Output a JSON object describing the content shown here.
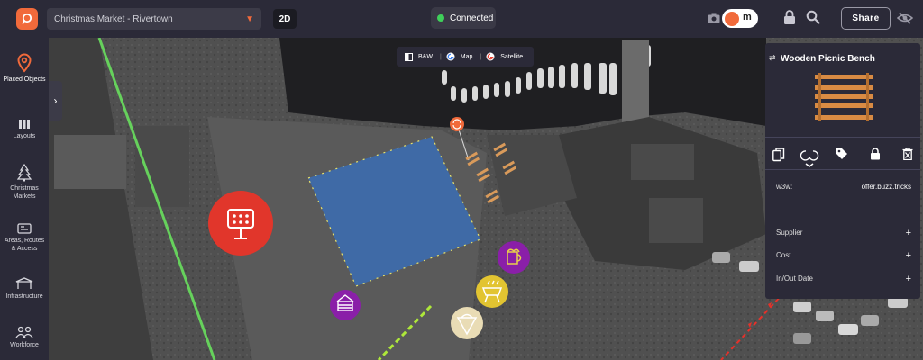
{
  "header": {
    "project": "Christmas Market - Rivertown",
    "view_mode": "2D",
    "status": "Connected",
    "toggle_label": "m",
    "share_label": "Share"
  },
  "sidebar": {
    "items": [
      {
        "label": "Placed Objects",
        "icon": "location-pin-icon"
      },
      {
        "label": "Layouts",
        "icon": "columns-icon"
      },
      {
        "label": "Christmas Markets",
        "icon": "tree-icon"
      },
      {
        "label": "Areas, Routes & Access",
        "icon": "route-icon"
      },
      {
        "label": "Infrastructure",
        "icon": "tent-icon"
      },
      {
        "label": "Workforce",
        "icon": "people-icon"
      }
    ]
  },
  "map": {
    "types": [
      "B&W",
      "Map",
      "Satellite"
    ]
  },
  "panel": {
    "title": "Wooden Picnic Bench",
    "w3w_label": "w3w:",
    "w3w_value": "offer.buzz.tricks",
    "properties": [
      "Supplier",
      "Cost",
      "In/Out Date"
    ]
  },
  "colors": {
    "accent": "#f16a3b",
    "panel_bg": "#2b2a38",
    "area_fill": "#3f6aa6",
    "status_green": "#3fd05a"
  }
}
